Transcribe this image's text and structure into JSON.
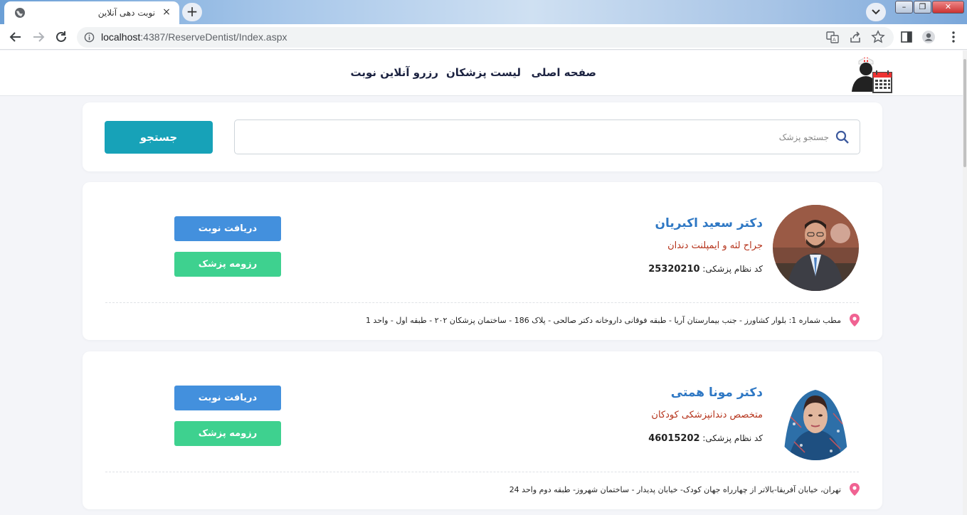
{
  "browser": {
    "tab_title": "نوبت دهی آنلاین",
    "tab_close": "×",
    "new_tab": "+",
    "url_host": "localhost",
    "url_rest": ":4387/ReserveDentist/Index.aspx"
  },
  "site": {
    "nav": {
      "home": "صفحه اصلی",
      "doctors": "لیست پزشکان",
      "reserve": "رزرو آنلاین نوبت"
    },
    "search": {
      "placeholder": "جستجو پزشک",
      "button_label": "جستجو"
    },
    "doctors": [
      {
        "name": "دکتر سعید اکبریان",
        "specialty": "جراح لثه و ایمپلنت دندان",
        "code_label": "کد نظام پزشکی:",
        "code": "25320210",
        "reserve_label": "دریافت نوبت",
        "resume_label": "رزومه پزشک",
        "address": "مطب شماره 1: بلوار کشاورز - جنب بیمارستان آریا - طبقه فوقانی داروخانه دکتر صالحی - پلاک 186 - ساختمان پزشکان ۲۰۲ - طبقه اول - واحد 1"
      },
      {
        "name": "دکتر مونا همتی",
        "specialty": "متخصص دندانپزشکی کودکان",
        "code_label": "کد نظام پزشکی:",
        "code": "46015202",
        "reserve_label": "دریافت نوبت",
        "resume_label": "رزومه پزشک",
        "address": "تهران، خیابان آفریقا-بالاتر از چهارراه جهان کودک- خیابان پدیدار - ساختمان شهروز- طبقه دوم واحد 24"
      }
    ]
  },
  "colors": {
    "accent": "#17a2b8",
    "reserve_button": "#4390dd",
    "resume_button": "#3ed18f",
    "doctor_name": "#2f78c4",
    "specialty": "#b5321a",
    "pin": "#f06292"
  }
}
